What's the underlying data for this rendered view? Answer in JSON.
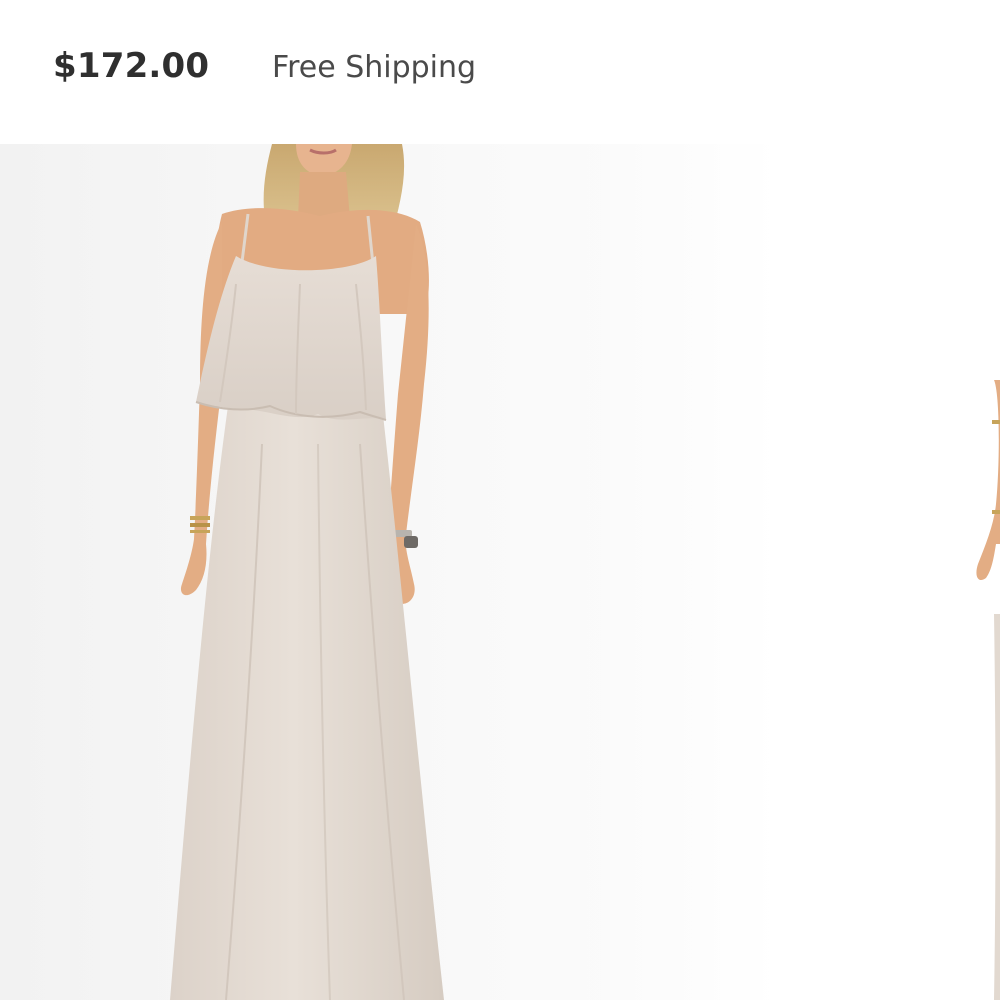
{
  "product": {
    "price": "$172.00",
    "shipping": "Free Shipping"
  },
  "gallery": {
    "images": [
      {
        "alt": "Model wearing a long light taupe maxi dress with flounce overlay bodice and spaghetti straps"
      },
      {
        "alt": "Partial view of the next product photo"
      }
    ],
    "dress_color": "#e4dcd4",
    "background_color": "#f4f4f4"
  }
}
